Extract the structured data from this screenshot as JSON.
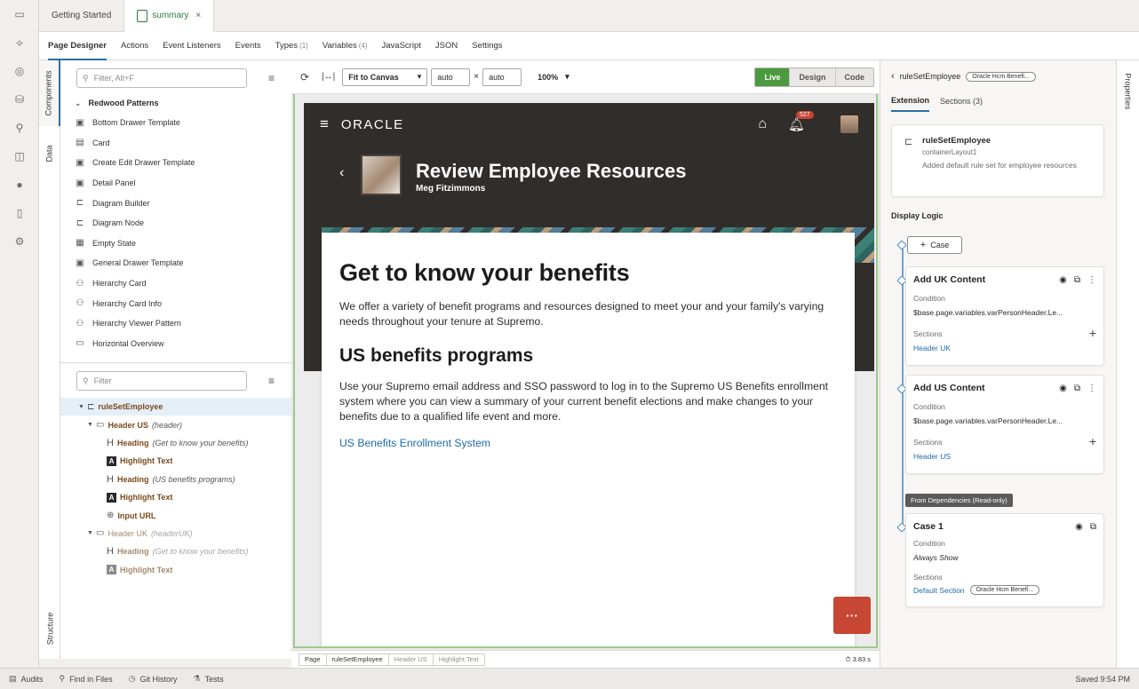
{
  "file_tabs": [
    {
      "label": "Getting Started"
    },
    {
      "label": "summary",
      "close": "×"
    }
  ],
  "sub_tabs": [
    {
      "label": "Page Designer",
      "count": ""
    },
    {
      "label": "Actions",
      "count": ""
    },
    {
      "label": "Event Listeners",
      "count": ""
    },
    {
      "label": "Events",
      "count": ""
    },
    {
      "label": "Types",
      "count": "(1)"
    },
    {
      "label": "Variables",
      "count": "(4)"
    },
    {
      "label": "JavaScript",
      "count": ""
    },
    {
      "label": "JSON",
      "count": ""
    },
    {
      "label": "Settings",
      "count": ""
    }
  ],
  "vertical_tabs": {
    "components": "Components",
    "data": "Data",
    "structure": "Structure"
  },
  "components": {
    "filter_placeholder": "Filter, Alt+F",
    "group": "Redwood Patterns",
    "items": [
      {
        "label": "Bottom Drawer Template",
        "icon": "drawer-icon"
      },
      {
        "label": "Card",
        "icon": "card-icon"
      },
      {
        "label": "Create Edit Drawer Template",
        "icon": "drawer-icon"
      },
      {
        "label": "Detail Panel",
        "icon": "panel-icon"
      },
      {
        "label": "Diagram Builder",
        "icon": "diagram-icon"
      },
      {
        "label": "Diagram Node",
        "icon": "diagram-icon"
      },
      {
        "label": "Empty State",
        "icon": "empty-state-icon"
      },
      {
        "label": "General Drawer Template",
        "icon": "drawer-icon"
      },
      {
        "label": "Hierarchy Card",
        "icon": "hierarchy-icon"
      },
      {
        "label": "Hierarchy Card Info",
        "icon": "hierarchy-icon"
      },
      {
        "label": "Hierarchy Viewer Pattern",
        "icon": "hierarchy-icon"
      },
      {
        "label": "Horizontal Overview",
        "icon": "overview-icon"
      }
    ]
  },
  "structure": {
    "filter_placeholder": "Filter",
    "root": "ruleSetEmployee",
    "header_us": {
      "label": "Header US",
      "sub": "(header)"
    },
    "us_children": [
      {
        "type": "heading",
        "label": "Heading",
        "sub": "(Get to know your benefits)"
      },
      {
        "type": "highlight",
        "label": "Highlight Text",
        "sub": ""
      },
      {
        "type": "heading",
        "label": "Heading",
        "sub": "(US benefits programs)"
      },
      {
        "type": "highlight",
        "label": "Highlight Text",
        "sub": ""
      },
      {
        "type": "url",
        "label": "Input URL",
        "sub": ""
      }
    ],
    "header_uk": {
      "label": "Header UK",
      "sub": "(headerUK)"
    },
    "uk_children": [
      {
        "type": "heading",
        "label": "Heading",
        "sub": "(Get to know your benefits)"
      },
      {
        "type": "highlight",
        "label": "Highlight Text",
        "sub": ""
      }
    ]
  },
  "canvas_toolbar": {
    "fit": "Fit to Canvas",
    "width": "auto",
    "height": "auto",
    "times": "×",
    "zoom": "100%",
    "modes": [
      "Live",
      "Design",
      "Code"
    ]
  },
  "app": {
    "brand": "ORACLE",
    "notif_count": "527",
    "title": "Review Employee Resources",
    "subtitle": "Meg Fitzimmons",
    "h1": "Get to know your benefits",
    "p1": "We offer a variety of benefit programs and resources designed to meet your and your family's varying needs throughout your tenure at Supremo.",
    "h2": "US benefits programs",
    "p2": "Use your Supremo email address and SSO password to log in to the Supremo US Benefits enrollment system where you can view a summary of your current benefit elections and make changes to your benefits due to a qualified life event and more.",
    "link": "US Benefits Enrollment System"
  },
  "breadcrumb": {
    "items": [
      "Page",
      "ruleSetEmployee",
      "Header US",
      "Highlight Text"
    ],
    "timing": "3.83 s"
  },
  "right_panel": {
    "title": "ruleSetEmployee",
    "pill": "Oracle Hcm Benefi...",
    "tabs": [
      "Extension",
      "Sections (3)"
    ],
    "summary": {
      "name": "ruleSetEmployee",
      "id": "containerLayout1",
      "desc": "Added default rule set for employee resources"
    },
    "display_logic": "Display Logic",
    "case_button": "Case",
    "cases": [
      {
        "title": "Add UK Content",
        "condition_label": "Condition",
        "condition": "$base.page.variables.varPersonHeader.Le...",
        "sections_label": "Sections",
        "section": "Header UK"
      },
      {
        "title": "Add US Content",
        "condition_label": "Condition",
        "condition": "$base.page.variables.varPersonHeader.Le...",
        "sections_label": "Sections",
        "section": "Header US"
      }
    ],
    "dependencies_label": "From Dependencies (Read-only)",
    "default_case": {
      "title": "Case 1",
      "condition_label": "Condition",
      "condition": "Always Show",
      "sections_label": "Sections",
      "section": "Default Section",
      "pill": "Oracle Hcm Benefi..."
    },
    "properties_tab": "Properties"
  },
  "status_bar": {
    "items": [
      {
        "label": "Audits",
        "icon": "audits-icon"
      },
      {
        "label": "Find in Files",
        "icon": "search-icon"
      },
      {
        "label": "Git History",
        "icon": "history-icon"
      },
      {
        "label": "Tests",
        "icon": "tests-icon"
      }
    ],
    "saved": "Saved 9:54 PM"
  }
}
